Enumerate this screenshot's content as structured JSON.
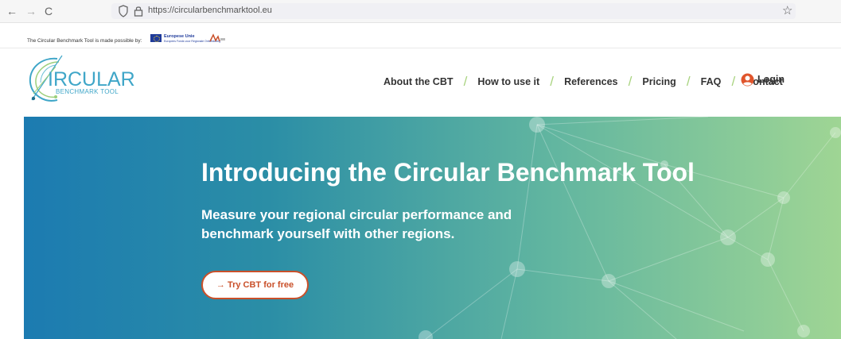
{
  "browser": {
    "back": "←",
    "forward": "→",
    "reload": "C",
    "url": "https://circularbenchmarktool.eu",
    "bookmark_icon": "star-icon"
  },
  "sponsor": {
    "text": "The Circular Benchmark Tool is made possible by:",
    "eu_label": "Europese Unie",
    "eu_sub": "Europees Fonds voor Regionale Ontwikkeling"
  },
  "logo": {
    "title": "IRCULAR",
    "subtitle": "BENCHMARK TOOL"
  },
  "nav": {
    "items": [
      "About the CBT",
      "How to use it",
      "References",
      "Pricing",
      "FAQ",
      "Contact"
    ],
    "separator": "/",
    "login": "Login"
  },
  "hero": {
    "title": "Introducing the Circular Benchmark Tool",
    "subtitle": "Measure your regional circular performance and benchmark yourself with other regions.",
    "cta": "→ Try CBT for free"
  },
  "colors": {
    "accent": "#c9502a",
    "brand": "#3fa6c8",
    "separator": "#a8d37f",
    "hero_start": "#1c7bb1",
    "hero_end": "#9fd594"
  }
}
